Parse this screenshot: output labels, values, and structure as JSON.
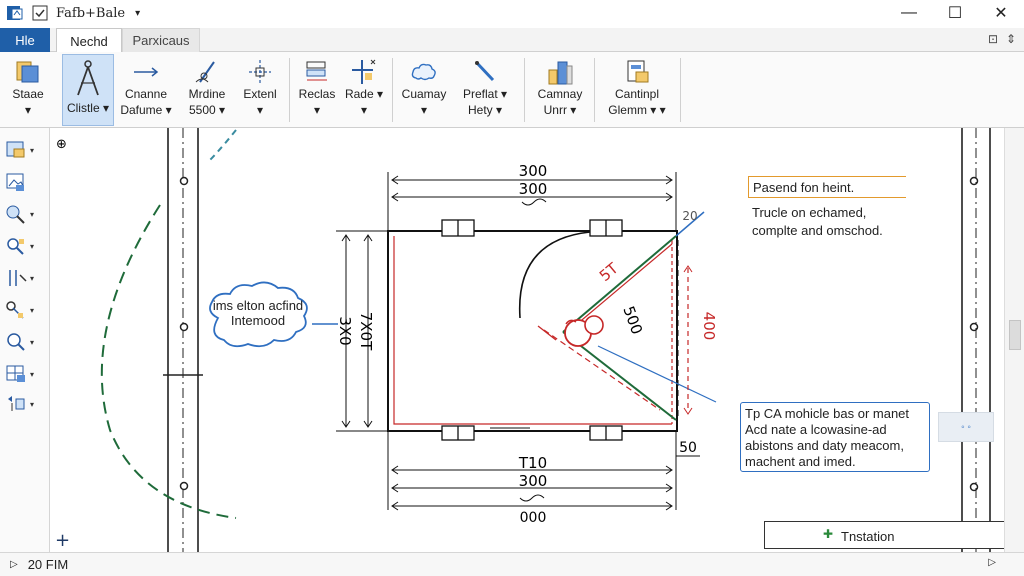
{
  "window": {
    "title": "Fafb+Bale",
    "dropdown_glyph": "▾",
    "min_glyph": "—",
    "max_glyph": "☐",
    "close_glyph": "✕"
  },
  "tabs": [
    {
      "label": "Hle"
    },
    {
      "label": "Nechd"
    },
    {
      "label": "Parxicaus"
    }
  ],
  "ribbon_controls": {
    "restore": "⊡",
    "pin": "⇕"
  },
  "ribbon": {
    "buttons": [
      {
        "label": "Staae",
        "sub": "▾"
      },
      {
        "label": "Clistle",
        "sub": "▾"
      },
      {
        "label": "Cnanne",
        "sub": "Dafume ▾"
      },
      {
        "label": "Mrdine",
        "sub": "5500 ▾"
      },
      {
        "label": "Extenl",
        "sub": "▾"
      },
      {
        "label": "Reclas",
        "sub": "▾"
      },
      {
        "label": "Rade ▾",
        "sub": "▾"
      },
      {
        "label": "Cuamay",
        "sub": "▾"
      },
      {
        "label": "Preflat ▾",
        "sub": "Hety ▾"
      },
      {
        "label": "Camnay",
        "sub": "Unrr ▾"
      },
      {
        "label": "Cantinpl",
        "sub": "Glemm ▾ ▾"
      }
    ]
  },
  "left_toolbar_arrow": "▾",
  "canvas": {
    "snap_glyph": "⊕",
    "plus_glyph": "+",
    "dims": {
      "top1": "300",
      "top2": "300",
      "left_outer": "3X0",
      "left_inner": "7X0T",
      "bottom1": "T10",
      "bottom2": "300",
      "bottom3": "000",
      "right": "400",
      "diag1": "5T",
      "diag2": "500",
      "corner": "50",
      "small": "20"
    }
  },
  "notes": {
    "orange_label": "Pasend fon heint.",
    "orange_line1": "Trucle on echamed,",
    "orange_line2": "complte and omschod.",
    "blue_text": "Tp CA mohicle bas or manet Acd nate a lcowasine-ad abistons and daty meacom, machent and imed.",
    "cloud_text": "ims elton acfind Intemood",
    "float_btn": "◦ ◦",
    "install_icon": "✚",
    "install_text": "Tnstation"
  },
  "status": {
    "arrow": "▷",
    "text": "20 FIM",
    "right_arrow": "▷"
  },
  "colors": {
    "accent": "#1f5fa8",
    "drawing_red": "#c62828",
    "drawing_green": "#1f6b3a",
    "annot_blue": "#2f6fc1",
    "annot_orange": "#e39a2d"
  }
}
